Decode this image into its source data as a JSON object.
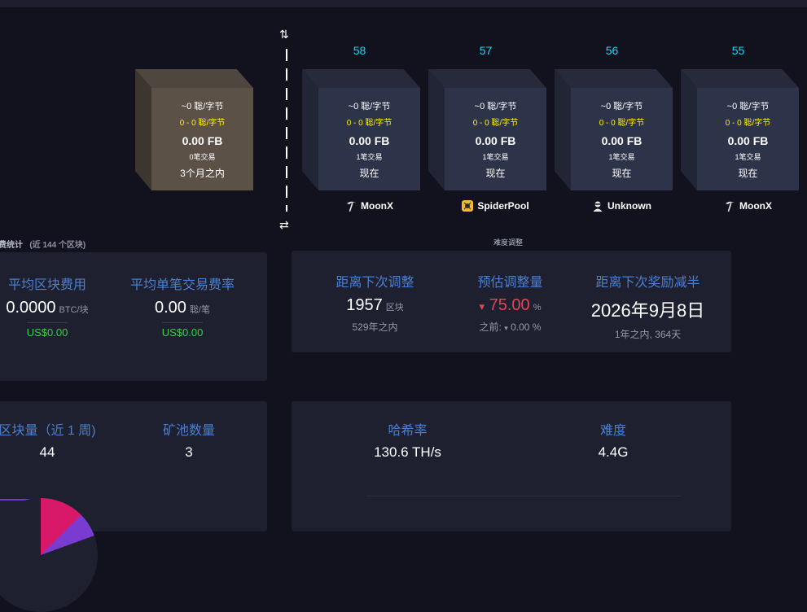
{
  "projected_block": {
    "fee_rate": "~0 聡/字节",
    "fee_span": "0 - 0 聡/字节",
    "total_fees": "0.00 FB",
    "tx_count": "0笔交易",
    "time": "3个月之内"
  },
  "mined_blocks": [
    {
      "height": "58",
      "fee_rate": "~0 聡/字节",
      "fee_span": "0 - 0 聡/字节",
      "total_fees": "0.00 FB",
      "tx_count": "1笔交易",
      "time": "现在",
      "pool": "MoonX",
      "pool_icon": "pickaxe-icon"
    },
    {
      "height": "57",
      "fee_rate": "~0 聡/字节",
      "fee_span": "0 - 0 聡/字节",
      "total_fees": "0.00 FB",
      "tx_count": "1笔交易",
      "time": "现在",
      "pool": "SpiderPool",
      "pool_icon": "spiderpool-logo-icon"
    },
    {
      "height": "56",
      "fee_rate": "~0 聡/字节",
      "fee_span": "0 - 0 聡/字节",
      "total_fees": "0.00 FB",
      "tx_count": "1笔交易",
      "time": "现在",
      "pool": "Unknown",
      "pool_icon": "anonymous-miner-icon"
    },
    {
      "height": "55",
      "fee_rate": "~0 聡/字节",
      "fee_span": "0 - 0 聡/字节",
      "total_fees": "0.00 FB",
      "tx_count": "1笔交易",
      "time": "现在",
      "pool": "MoonX",
      "pool_icon": "pickaxe-icon"
    }
  ],
  "section_titles": {
    "fees": "费统计",
    "fees_range": "(近 144 个区块)",
    "difficulty": "难度调整"
  },
  "fees_panel": {
    "avg_block_fee_label": "平均区块费用",
    "avg_block_fee_value": "0.0000",
    "avg_block_fee_unit": "BTC/块",
    "avg_block_fee_usd": "US$0.00",
    "avg_tx_fee_label": "平均单笔交易费率",
    "avg_tx_fee_value": "0.00",
    "avg_tx_fee_unit": "聡/笔",
    "avg_tx_fee_usd": "US$0.00"
  },
  "difficulty_panel": {
    "next_adjust_label": "距离下次调整",
    "next_adjust_value": "1957",
    "next_adjust_unit": "区块",
    "next_adjust_sub": "529年之内",
    "estimate_label": "预估调整量",
    "estimate_arrow": "▾",
    "estimate_value": "75.00",
    "estimate_unit": "%",
    "previous_label": "之前:",
    "previous_arrow": "▾",
    "previous_value": "0.00 %",
    "halving_label": "距离下次奖励减半",
    "halving_value": "2026年9月8日",
    "halving_sub": "1年之内, 364天"
  },
  "pools_panel": {
    "blocks_label": "区块量（近 1 周)",
    "blocks_value": "44",
    "pools_label": "矿池数量",
    "pools_value": "3"
  },
  "hashrate_panel": {
    "hashrate_label": "哈希率",
    "hashrate_value": "130.6 TH/s",
    "difficulty_label": "难度",
    "difficulty_value": "4.4G"
  },
  "colors": {
    "background": "#11121d",
    "panel": "#1e2030",
    "label_blue": "#4a7fd1",
    "height_cyan": "#1bd8f4",
    "usd_green": "#3bcc49",
    "negative_red": "#e44554",
    "fee_yellow": "#fff200"
  }
}
